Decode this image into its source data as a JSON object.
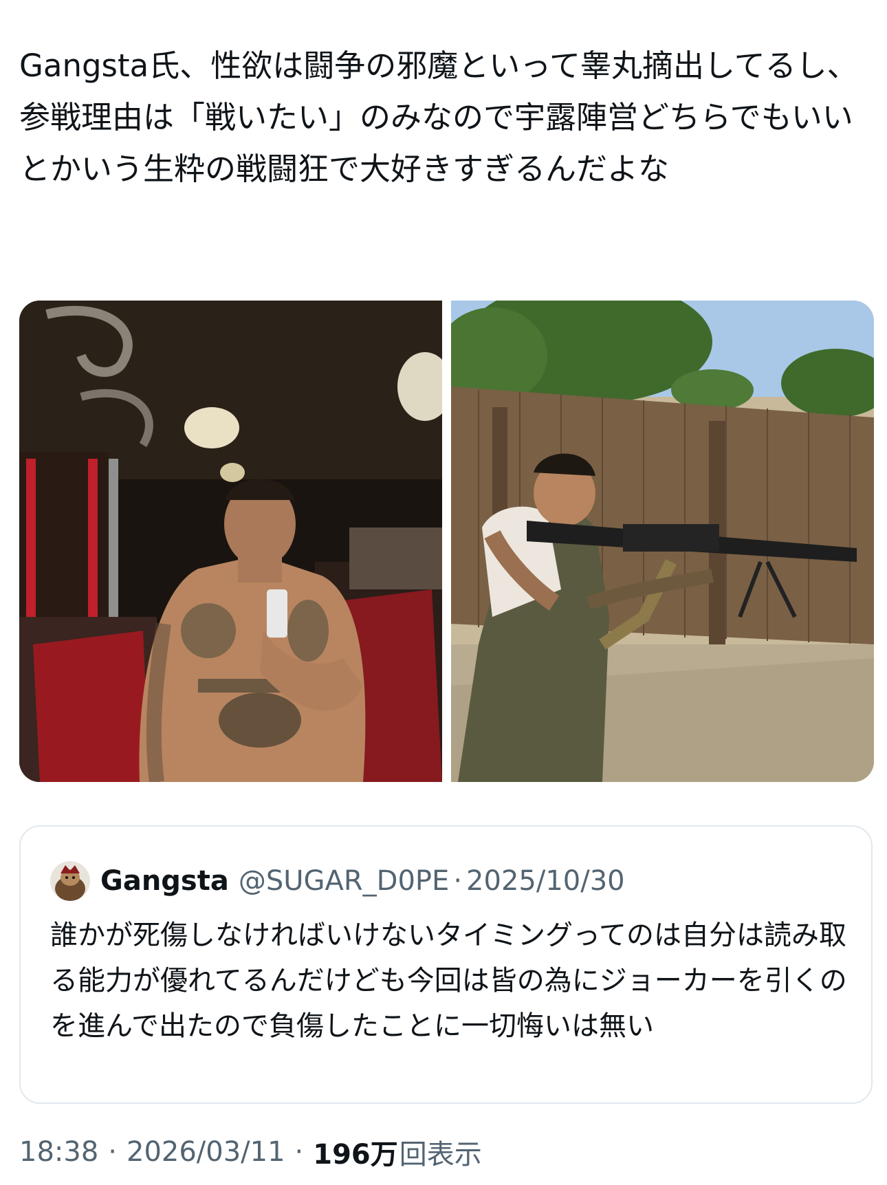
{
  "tweet": {
    "text": "Gangsta氏、性欲は闘争の邪魔といって睾丸摘出してるし、参戦理由は「戦いたい」のみなので宇露陣営どちらでもいいとかいう生粋の戦闘狂で大好きすぎるんだよな"
  },
  "media": [
    {
      "icon": "photo-gym-selfie"
    },
    {
      "icon": "photo-machine-gun-outdoor"
    }
  ],
  "quote": {
    "avatar_icon": "avatar-icon",
    "name": "Gangsta",
    "handle": "@SUGAR_D0PE",
    "separator": "·",
    "date": "2025/10/30",
    "text": "誰かが死傷しなければいけないタイミングってのは自分は読み取る能力が優れてるんだけども今回は皆の為にジョーカーを引くのを進んで出たので負傷したことに一切悔いは無い"
  },
  "meta": {
    "time": "18:38",
    "separator": "·",
    "date": "2026/03/11",
    "views_count": "196",
    "views_unit": "万",
    "views_label": "回表示"
  }
}
